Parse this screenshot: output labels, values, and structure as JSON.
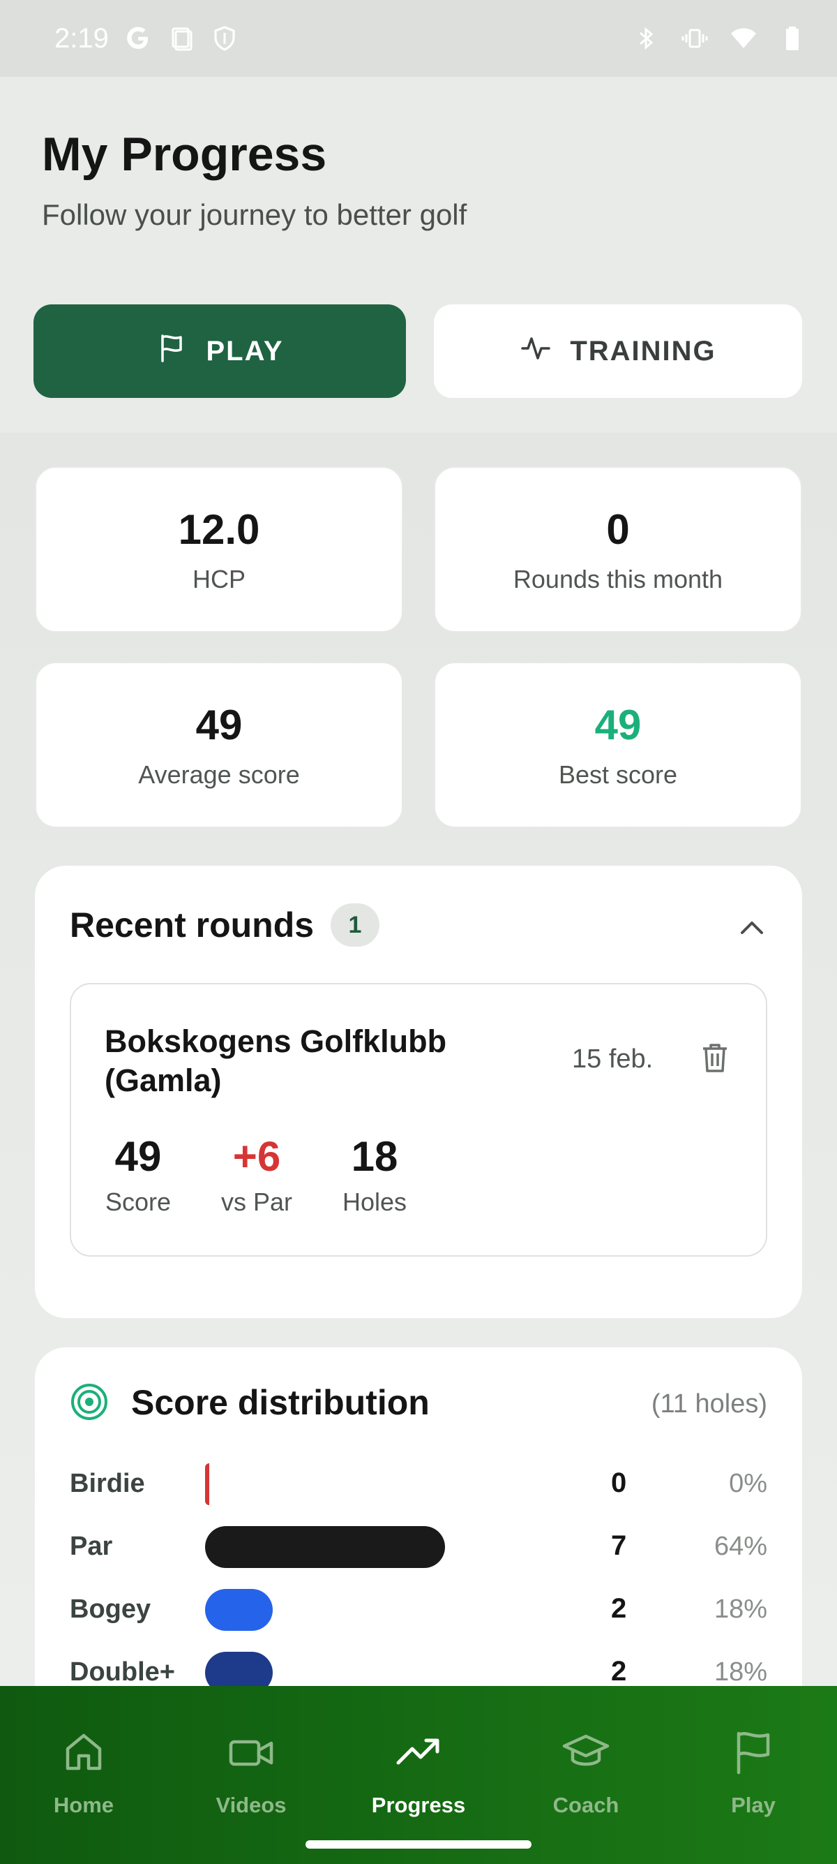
{
  "status_bar": {
    "time": "2:19",
    "left_icons": [
      "google-icon",
      "screenshot-icon",
      "shield-icon"
    ],
    "right_icons": [
      "bluetooth-icon",
      "vibrate-icon",
      "wifi-icon",
      "battery-icon"
    ]
  },
  "header": {
    "title": "My Progress",
    "subtitle": "Follow your journey to better golf",
    "play_label": "PLAY",
    "training_label": "TRAINING"
  },
  "stats": {
    "hcp_value": "12.0",
    "hcp_label": "HCP",
    "rounds_value": "0",
    "rounds_label": "Rounds this month",
    "avg_value": "49",
    "avg_label": "Average score",
    "best_value": "49",
    "best_label": "Best score"
  },
  "recent": {
    "title": "Recent rounds",
    "count": "1",
    "rounds": [
      {
        "course": "Bokskogens Golfklubb (Gamla)",
        "date": "15 feb.",
        "score": "49",
        "score_label": "Score",
        "vs_par": "+6",
        "vs_par_label": "vs Par",
        "holes": "18",
        "holes_label": "Holes"
      }
    ]
  },
  "distribution": {
    "title": "Score distribution",
    "note": "(11 holes)",
    "rows": [
      {
        "label": "Birdie",
        "count": "0",
        "pct": "0%",
        "fraction": 0.0,
        "color": "#d63535"
      },
      {
        "label": "Par",
        "count": "7",
        "pct": "64%",
        "fraction": 0.64,
        "color": "#1a1a1a"
      },
      {
        "label": "Bogey",
        "count": "2",
        "pct": "18%",
        "fraction": 0.18,
        "color": "#2563eb"
      },
      {
        "label": "Double+",
        "count": "2",
        "pct": "18%",
        "fraction": 0.18,
        "color": "#1e3a8a"
      }
    ]
  },
  "colors": {
    "brand_green": "#1f6343",
    "nav_green": "#1c7a16",
    "best_score_green": "#1bb07a",
    "over_par_red": "#d63535"
  },
  "nav": [
    {
      "label": "Home",
      "icon": "home-icon",
      "active": false
    },
    {
      "label": "Videos",
      "icon": "video-icon",
      "active": false
    },
    {
      "label": "Progress",
      "icon": "trending-up-icon",
      "active": true
    },
    {
      "label": "Coach",
      "icon": "graduation-cap-icon",
      "active": false
    },
    {
      "label": "Play",
      "icon": "flag-icon",
      "active": false
    }
  ]
}
